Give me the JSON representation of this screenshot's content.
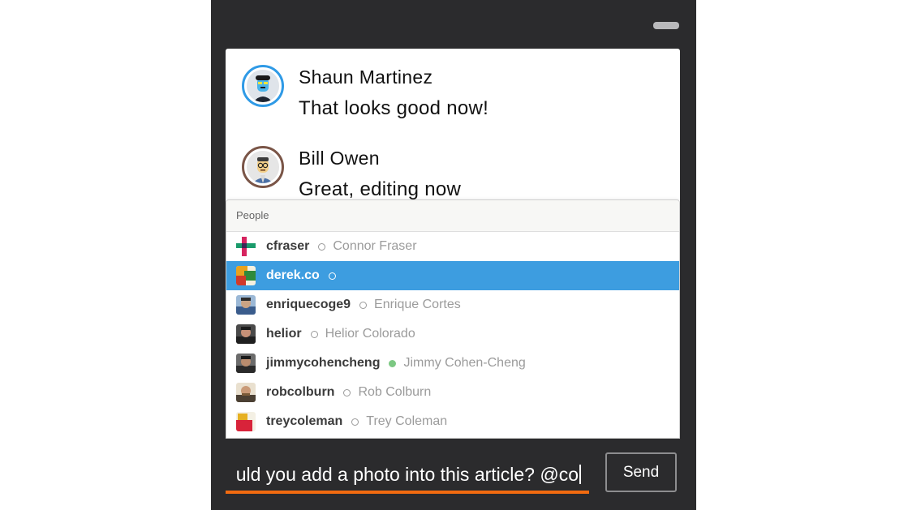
{
  "window": {
    "minimize_icon": "minimize-icon"
  },
  "messages": [
    {
      "name": "Shaun Martinez",
      "text": "That looks good now!",
      "avatar_ring_color": "#2f9ae6",
      "avatar_icon": "avatar-shaun-martinez-icon"
    },
    {
      "name": "Bill Owen",
      "text": "Great, editing now",
      "avatar_ring_color": "#7a5547",
      "avatar_icon": "avatar-bill-owen-icon"
    }
  ],
  "mention_popup": {
    "header": "People",
    "selected_index": 1,
    "people": [
      {
        "username": "cfraser",
        "fullname": "Connor Fraser",
        "status": "away"
      },
      {
        "username": "derek.co",
        "fullname": "",
        "status": "away"
      },
      {
        "username": "enriquecoge9",
        "fullname": "Enrique Cortes",
        "status": "away"
      },
      {
        "username": "helior",
        "fullname": "Helior Colorado",
        "status": "away"
      },
      {
        "username": "jimmycohencheng",
        "fullname": "Jimmy Cohen-Cheng",
        "status": "online"
      },
      {
        "username": "robcolburn",
        "fullname": "Rob Colburn",
        "status": "away"
      },
      {
        "username": "treycoleman",
        "fullname": "Trey Coleman",
        "status": "away"
      }
    ]
  },
  "composer": {
    "value": "uld you add a photo into this article? @co",
    "underline_color": "#f26b10"
  },
  "send_button": {
    "label": "Send"
  },
  "colors": {
    "selection": "#3d9de0",
    "online": "#7cc883",
    "panel_bg": "#2b2b2d"
  }
}
